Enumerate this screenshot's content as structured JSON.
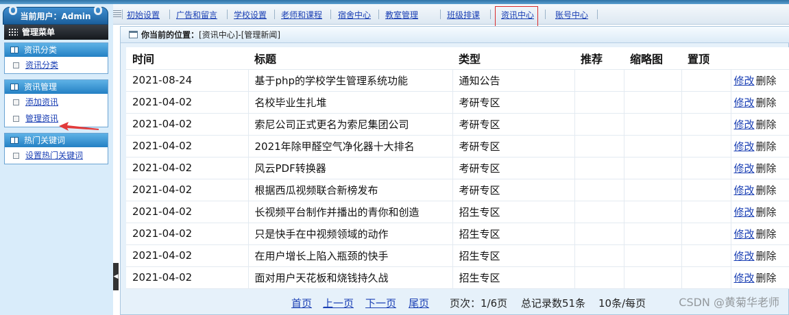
{
  "user_tab": {
    "label": "当前用户：Admin"
  },
  "sidebar": {
    "menu_title": "管理菜单",
    "groups": [
      {
        "title": "资讯分类",
        "items": [
          {
            "label": "资讯分类"
          }
        ]
      },
      {
        "title": "资讯管理",
        "items": [
          {
            "label": "添加资讯"
          },
          {
            "label": "管理资讯"
          }
        ]
      },
      {
        "title": "热门关键词",
        "items": [
          {
            "label": "设置热门关键词"
          }
        ]
      }
    ]
  },
  "topnav": {
    "items": [
      {
        "label": "初始设置"
      },
      {
        "label": "广告和留言"
      },
      {
        "label": "学校设置"
      },
      {
        "label": "老师和课程"
      },
      {
        "label": "宿舍中心"
      },
      {
        "label": "教室管理"
      },
      {
        "label": "班级排课"
      },
      {
        "label": "资讯中心"
      },
      {
        "label": "账号中心"
      }
    ],
    "active_index": 7
  },
  "location": {
    "prefix": "你当前的位置：",
    "path": "[资讯中心]-[管理新闻]"
  },
  "table": {
    "headers": [
      "时间",
      "标题",
      "类型",
      "推荐",
      "缩略图",
      "置顶",
      ""
    ],
    "edit_label": "修改",
    "delete_label": "删除",
    "rows": [
      {
        "date": "2021-08-24",
        "title": "基于php的学校学生管理系统功能",
        "type": "通知公告"
      },
      {
        "date": "2021-04-02",
        "title": "名校毕业生扎堆",
        "type": "考研专区"
      },
      {
        "date": "2021-04-02",
        "title": "索尼公司正式更名为索尼集团公司",
        "type": "考研专区"
      },
      {
        "date": "2021-04-02",
        "title": "2021年除甲醛空气净化器十大排名",
        "type": "考研专区"
      },
      {
        "date": "2021-04-02",
        "title": "风云PDF转换器",
        "type": "考研专区"
      },
      {
        "date": "2021-04-02",
        "title": "根据西瓜视频联合新榜发布",
        "type": "考研专区"
      },
      {
        "date": "2021-04-02",
        "title": "长视频平台制作并播出的青你和创造",
        "type": "招生专区"
      },
      {
        "date": "2021-04-02",
        "title": "只是快手在中视频领域的动作",
        "type": "招生专区"
      },
      {
        "date": "2021-04-02",
        "title": "在用户增长上陷入瓶颈的快手",
        "type": "招生专区"
      },
      {
        "date": "2021-04-02",
        "title": "面对用户天花板和烧钱持久战",
        "type": "招生专区"
      }
    ]
  },
  "pager": {
    "first": "首页",
    "prev": "上一页",
    "next": "下一页",
    "last": "尾页",
    "page_info": "页次：1/6页",
    "total_info": "总记录数51条",
    "per_page": "10条/每页"
  },
  "watermark": "CSDN @黄菊华老师",
  "colors": {
    "accent_blue": "#2480c4",
    "link": "#1a3fb4",
    "highlight_red": "#d92a2a"
  }
}
